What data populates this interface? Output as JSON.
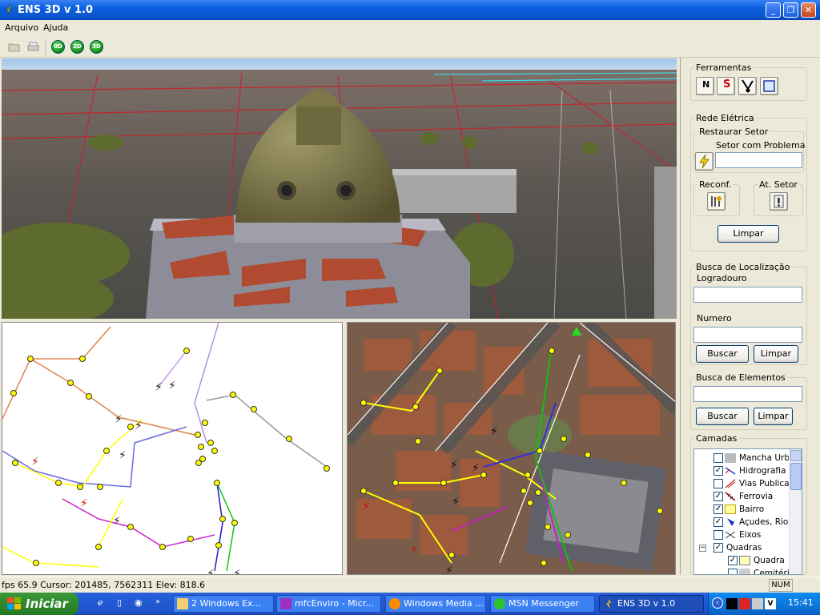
{
  "window": {
    "title": "ENS 3D v 1.0"
  },
  "menu": {
    "items": [
      "Arquivo",
      "Ajuda"
    ]
  },
  "toolbar": {
    "view_buttons": [
      "0D",
      "2D",
      "3D"
    ]
  },
  "panel": {
    "ferramentas": {
      "legend": "Ferramentas",
      "tools": [
        "N",
        "S"
      ]
    },
    "rede": {
      "legend": "Rede Elétrica",
      "restaurar_legend": "Restaurar Setor",
      "setor_label": "Setor com Problema",
      "setor_value": "",
      "reconf_legend": "Reconf.",
      "at_setor_legend": "At. Setor",
      "limpar": "Limpar"
    },
    "busca_local": {
      "legend": "Busca de Localização",
      "logradouro_label": "Logradouro",
      "logradouro_value": "",
      "numero_label": "Numero",
      "numero_value": "",
      "buscar": "Buscar",
      "limpar": "Limpar"
    },
    "busca_elem": {
      "legend": "Busca de Elementos",
      "value": "",
      "buscar": "Buscar",
      "limpar": "Limpar"
    },
    "camadas": {
      "legend": "Camadas",
      "layers": [
        {
          "label": "Mancha Urba",
          "checked": false
        },
        {
          "label": "Hidrografia L",
          "checked": true
        },
        {
          "label": "Vias Publicas",
          "checked": false
        },
        {
          "label": "Ferrovia",
          "checked": true
        },
        {
          "label": "Bairro",
          "checked": true
        },
        {
          "label": "Açudes, Rios",
          "checked": true
        },
        {
          "label": "Eixos",
          "checked": false
        },
        {
          "label": "Quadras",
          "checked": true
        },
        {
          "label": "Quadra",
          "checked": true
        },
        {
          "label": "Cemitério",
          "checked": false
        }
      ]
    }
  },
  "status": {
    "text": "fps 65.9  Cursor: 201485, 7562311  Elev: 818.6",
    "num": "NUM"
  },
  "taskbar": {
    "start": "Iniciar",
    "tasks": [
      "2 Windows Ex...",
      "mfcEnviro - Micr...",
      "Windows Media ...",
      "MSN Messenger",
      "ENS 3D v 1.0"
    ],
    "clock": "15:41"
  }
}
